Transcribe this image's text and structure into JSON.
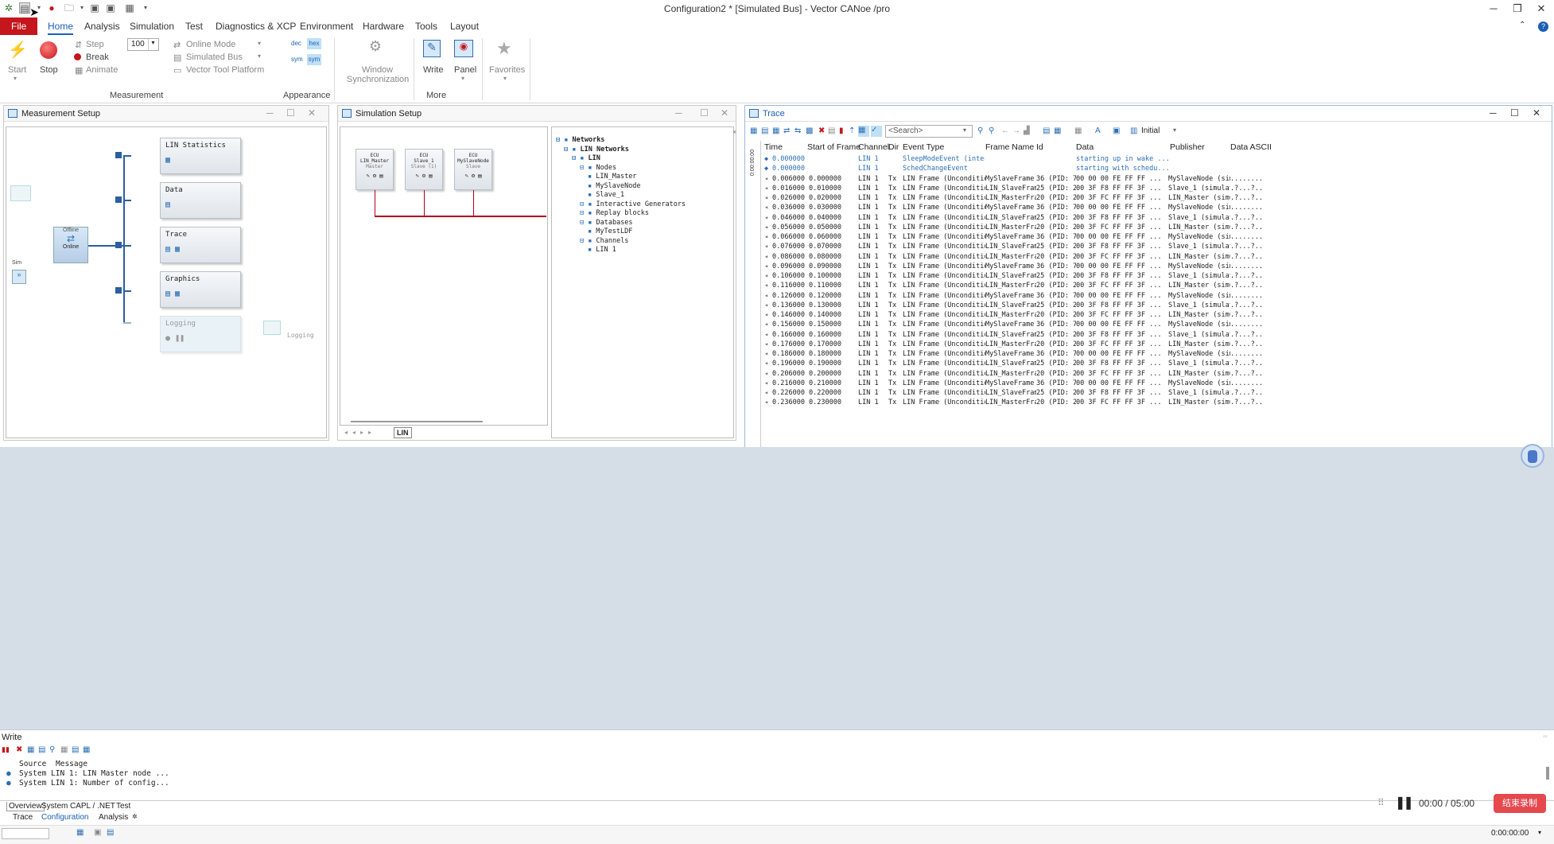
{
  "window": {
    "title": "Configuration2 * [Simulated Bus] - Vector CANoe /pro",
    "minimize": "─",
    "maximize": "❐",
    "close": "✕"
  },
  "menu": [
    "File",
    "Home",
    "Analysis",
    "Simulation",
    "Test",
    "Diagnostics & XCP",
    "Environment",
    "Hardware",
    "Tools",
    "Layout"
  ],
  "ribbon": {
    "start": "Start",
    "stop": "Stop",
    "step": "Step",
    "break": "Break",
    "animate": "Animate",
    "speed": "100",
    "online_mode": "Online Mode",
    "simulated_bus": "Simulated Bus",
    "vector_tool_platform": "Vector Tool Platform",
    "dec": "dec",
    "hex": "hex",
    "sym": "sym",
    "sym2": "sym",
    "window_sync_1": "Window",
    "window_sync_2": "Synchronization",
    "write": "Write",
    "panel": "Panel",
    "favorites": "Favorites",
    "group_measurement": "Measurement",
    "group_appearance": "Appearance",
    "group_more": "More"
  },
  "measurement_setup": {
    "title": "Measurement Setup",
    "blocks": [
      "LIN Statistics",
      "Data",
      "Trace",
      "Graphics",
      "Logging"
    ],
    "logging_label": "Logging",
    "offline": "Offline",
    "online": "Online",
    "sim": "Sim"
  },
  "simulation_setup": {
    "title": "Simulation Setup",
    "nodes": [
      {
        "title": "ECU",
        "name": "LIN_Master",
        "sub": "Master"
      },
      {
        "title": "ECU",
        "name": "Slave_1",
        "sub": "Slave (1)"
      },
      {
        "title": "ECU",
        "name": "MySlaveNode",
        "sub": "Slave"
      }
    ],
    "tab": "LIN",
    "tree": [
      {
        "indent": 0,
        "text": "Networks",
        "bold": true
      },
      {
        "indent": 1,
        "text": "LIN Networks",
        "bold": true
      },
      {
        "indent": 2,
        "text": "LIN",
        "bold": true
      },
      {
        "indent": 3,
        "text": "Nodes",
        "bold": false
      },
      {
        "indent": 4,
        "text": "LIN_Master",
        "bold": false
      },
      {
        "indent": 4,
        "text": "MySlaveNode",
        "bold": false
      },
      {
        "indent": 4,
        "text": "Slave_1",
        "bold": false
      },
      {
        "indent": 3,
        "text": "Interactive Generators",
        "bold": false
      },
      {
        "indent": 3,
        "text": "Replay blocks",
        "bold": false
      },
      {
        "indent": 3,
        "text": "Databases",
        "bold": false
      },
      {
        "indent": 4,
        "text": "MyTestLDF",
        "bold": false
      },
      {
        "indent": 3,
        "text": "Channels",
        "bold": false
      },
      {
        "indent": 4,
        "text": "LIN 1",
        "bold": false
      }
    ]
  },
  "trace": {
    "title": "Trace",
    "search_placeholder": "<Search>",
    "initial": "Initial",
    "time_ruler": "0:00:00:00",
    "columns": [
      "Time",
      "Start of Frame",
      "Channel",
      "Dir",
      "Event Type",
      "Frame Name",
      "Id",
      "Data",
      "Publisher",
      "Data ASCII"
    ],
    "rows": [
      [
        "0.000000",
        "",
        "LIN 1",
        "",
        "SleepModeEvent (intern...",
        "",
        "",
        "starting up in wake ...",
        "",
        ""
      ],
      [
        "0.000000",
        "",
        "LIN 1",
        "",
        "SchedChangeEvent",
        "",
        "",
        "starting with schedu...",
        "",
        ""
      ],
      [
        "0.006000",
        "0.000000",
        "LIN 1",
        "Tx",
        "LIN Frame (Unconditional)",
        "MySlaveFrame",
        "36 (PID: 76)",
        "00 00 00 FE FF FF ...",
        "MySlaveNode (simulated)",
        "........"
      ],
      [
        "0.016000",
        "0.010000",
        "LIN 1",
        "Tx",
        "LIN Frame (Unconditional)",
        "LIN_SlaveFrame",
        "25 (PID: 25)",
        "00 3F F8 FF FF 3F ...",
        "Slave_1 (simulated)",
        ".?...?.."
      ],
      [
        "0.026000",
        "0.020000",
        "LIN 1",
        "Tx",
        "LIN Frame (Unconditional)",
        "LIN_MasterFrame",
        "20 (PID: 20)",
        "00 3F FC FF FF 3F ...",
        "LIN_Master (simulated)",
        ".?...?.."
      ],
      [
        "0.036000",
        "0.030000",
        "LIN 1",
        "Tx",
        "LIN Frame (Unconditional)",
        "MySlaveFrame",
        "36 (PID: 76)",
        "00 00 00 FE FF FF ...",
        "MySlaveNode (simulated)",
        "........"
      ],
      [
        "0.046000",
        "0.040000",
        "LIN 1",
        "Tx",
        "LIN Frame (Unconditional)",
        "LIN_SlaveFrame",
        "25 (PID: 25)",
        "00 3F F8 FF FF 3F ...",
        "Slave_1 (simulated)",
        ".?...?.."
      ],
      [
        "0.056000",
        "0.050000",
        "LIN 1",
        "Tx",
        "LIN Frame (Unconditional)",
        "LIN_MasterFrame",
        "20 (PID: 20)",
        "00 3F FC FF FF 3F ...",
        "LIN_Master (simulated)",
        ".?...?.."
      ],
      [
        "0.066000",
        "0.060000",
        "LIN 1",
        "Tx",
        "LIN Frame (Unconditional)",
        "MySlaveFrame",
        "36 (PID: 76)",
        "00 00 00 FE FF FF ...",
        "MySlaveNode (simulated)",
        "........"
      ],
      [
        "0.076000",
        "0.070000",
        "LIN 1",
        "Tx",
        "LIN Frame (Unconditional)",
        "LIN_SlaveFrame",
        "25 (PID: 25)",
        "00 3F F8 FF FF 3F ...",
        "Slave_1 (simulated)",
        ".?...?.."
      ],
      [
        "0.086000",
        "0.080000",
        "LIN 1",
        "Tx",
        "LIN Frame (Unconditional)",
        "LIN_MasterFrame",
        "20 (PID: 20)",
        "00 3F FC FF FF 3F ...",
        "LIN_Master (simulated)",
        ".?...?.."
      ],
      [
        "0.096000",
        "0.090000",
        "LIN 1",
        "Tx",
        "LIN Frame (Unconditional)",
        "MySlaveFrame",
        "36 (PID: 76)",
        "00 00 00 FE FF FF ...",
        "MySlaveNode (simulated)",
        "........"
      ],
      [
        "0.106000",
        "0.100000",
        "LIN 1",
        "Tx",
        "LIN Frame (Unconditional)",
        "LIN_SlaveFrame",
        "25 (PID: 25)",
        "00 3F F8 FF FF 3F ...",
        "Slave_1 (simulated)",
        ".?...?.."
      ],
      [
        "0.116000",
        "0.110000",
        "LIN 1",
        "Tx",
        "LIN Frame (Unconditional)",
        "LIN_MasterFrame",
        "20 (PID: 20)",
        "00 3F FC FF FF 3F ...",
        "LIN_Master (simulated)",
        ".?...?.."
      ],
      [
        "0.126000",
        "0.120000",
        "LIN 1",
        "Tx",
        "LIN Frame (Unconditional)",
        "MySlaveFrame",
        "36 (PID: 76)",
        "00 00 00 FE FF FF ...",
        "MySlaveNode (simulated)",
        "........"
      ],
      [
        "0.136000",
        "0.130000",
        "LIN 1",
        "Tx",
        "LIN Frame (Unconditional)",
        "LIN_SlaveFrame",
        "25 (PID: 25)",
        "00 3F F8 FF FF 3F ...",
        "Slave_1 (simulated)",
        ".?...?.."
      ],
      [
        "0.146000",
        "0.140000",
        "LIN 1",
        "Tx",
        "LIN Frame (Unconditional)",
        "LIN_MasterFrame",
        "20 (PID: 20)",
        "00 3F FC FF FF 3F ...",
        "LIN_Master (simulated)",
        ".?...?.."
      ],
      [
        "0.156000",
        "0.150000",
        "LIN 1",
        "Tx",
        "LIN Frame (Unconditional)",
        "MySlaveFrame",
        "36 (PID: 76)",
        "00 00 00 FE FF FF ...",
        "MySlaveNode (simulated)",
        "........"
      ],
      [
        "0.166000",
        "0.160000",
        "LIN 1",
        "Tx",
        "LIN Frame (Unconditional)",
        "LIN_SlaveFrame",
        "25 (PID: 25)",
        "00 3F F8 FF FF 3F ...",
        "Slave_1 (simulated)",
        ".?...?.."
      ],
      [
        "0.176000",
        "0.170000",
        "LIN 1",
        "Tx",
        "LIN Frame (Unconditional)",
        "LIN_MasterFrame",
        "20 (PID: 20)",
        "00 3F FC FF FF 3F ...",
        "LIN_Master (simulated)",
        ".?...?.."
      ],
      [
        "0.186000",
        "0.180000",
        "LIN 1",
        "Tx",
        "LIN Frame (Unconditional)",
        "MySlaveFrame",
        "36 (PID: 76)",
        "00 00 00 FE FF FF ...",
        "MySlaveNode (simulated)",
        "........"
      ],
      [
        "0.196000",
        "0.190000",
        "LIN 1",
        "Tx",
        "LIN Frame (Unconditional)",
        "LIN_SlaveFrame",
        "25 (PID: 25)",
        "00 3F F8 FF FF 3F ...",
        "Slave_1 (simulated)",
        ".?...?.."
      ],
      [
        "0.206000",
        "0.200000",
        "LIN 1",
        "Tx",
        "LIN Frame (Unconditional)",
        "LIN_MasterFrame",
        "20 (PID: 20)",
        "00 3F FC FF FF 3F ...",
        "LIN_Master (simulated)",
        ".?...?.."
      ],
      [
        "0.216000",
        "0.210000",
        "LIN 1",
        "Tx",
        "LIN Frame (Unconditional)",
        "MySlaveFrame",
        "36 (PID: 76)",
        "00 00 00 FE FF FF ...",
        "MySlaveNode (simulated)",
        "........"
      ],
      [
        "0.226000",
        "0.220000",
        "LIN 1",
        "Tx",
        "LIN Frame (Unconditional)",
        "LIN_SlaveFrame",
        "25 (PID: 25)",
        "00 3F F8 FF FF 3F ...",
        "Slave_1 (simulated)",
        ".?...?.."
      ],
      [
        "0.236000",
        "0.230000",
        "LIN 1",
        "Tx",
        "LIN Frame (Unconditional)",
        "LIN_MasterFrame",
        "20 (PID: 20)",
        "00 3F FC FF FF 3F ...",
        "LIN_Master (simulated)",
        ".?...?.."
      ]
    ]
  },
  "write": {
    "title": "Write",
    "source_header": "Source",
    "message_header": "Message",
    "lines": [
      "System LIN 1: LIN Master node ...",
      "System LIN 1: Number of config..."
    ],
    "tabs": [
      "Overview",
      "System",
      "CAPL / .NET",
      "Test"
    ],
    "bottom_tabs": [
      "Trace",
      "Configuration",
      "Analysis"
    ]
  },
  "recorder": {
    "time": "00:00 / 05:00",
    "stop_label": "结束录制"
  },
  "status": {
    "time": "0:00:00:00"
  },
  "colors": {
    "accent": "#1a5fb4",
    "file_red": "#c4161c",
    "bg_blue": "#d5dde7",
    "rec_red": "#e5484d"
  }
}
